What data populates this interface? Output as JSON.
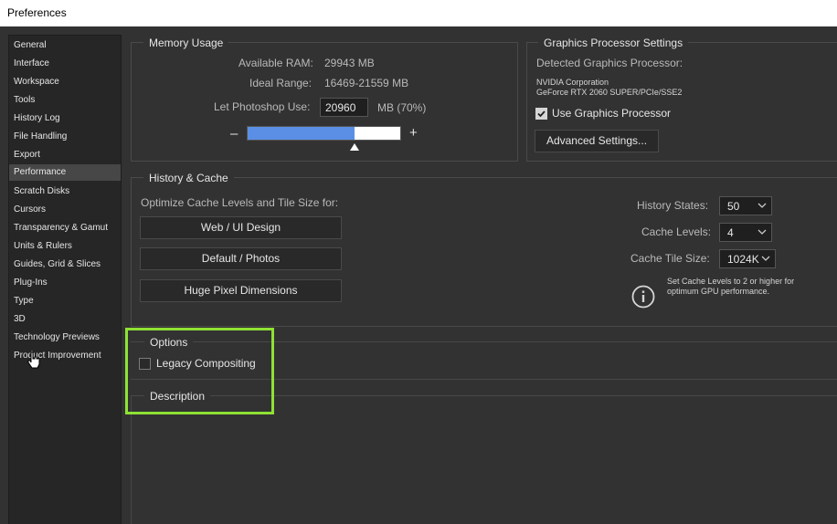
{
  "window": {
    "title": "Preferences"
  },
  "sidebar": {
    "items": [
      {
        "label": "General"
      },
      {
        "label": "Interface"
      },
      {
        "label": "Workspace"
      },
      {
        "label": "Tools"
      },
      {
        "label": "History Log"
      },
      {
        "label": "File Handling"
      },
      {
        "label": "Export"
      },
      {
        "label": "Performance",
        "active": true
      },
      {
        "label": "Scratch Disks"
      },
      {
        "label": "Cursors"
      },
      {
        "label": "Transparency & Gamut"
      },
      {
        "label": "Units & Rulers"
      },
      {
        "label": "Guides, Grid & Slices"
      },
      {
        "label": "Plug-Ins"
      },
      {
        "label": "Type"
      },
      {
        "label": "3D"
      },
      {
        "label": "Technology Previews"
      },
      {
        "label": "Product Improvement"
      }
    ]
  },
  "memory": {
    "title": "Memory Usage",
    "available_label": "Available RAM:",
    "available_value": "29943 MB",
    "ideal_label": "Ideal Range:",
    "ideal_value": "16469-21559 MB",
    "use_label": "Let Photoshop Use:",
    "use_value": "20960",
    "use_unit": "MB (70%)",
    "minus": "–",
    "plus": "+",
    "slider_fraction": 0.7
  },
  "gpu": {
    "title": "Graphics Processor Settings",
    "detected_label": "Detected Graphics Processor:",
    "vendor": "NVIDIA Corporation",
    "model": "GeForce RTX 2060 SUPER/PCIe/SSE2",
    "use_gpu_label": "Use Graphics Processor",
    "use_gpu_checked": true,
    "advanced_button": "Advanced Settings..."
  },
  "history_cache": {
    "title": "History & Cache",
    "optimize_label": "Optimize Cache Levels and Tile Size for:",
    "buttons": [
      "Web / UI Design",
      "Default / Photos",
      "Huge Pixel Dimensions"
    ],
    "history_states_label": "History States:",
    "history_states_value": "50",
    "cache_levels_label": "Cache Levels:",
    "cache_levels_value": "4",
    "tile_size_label": "Cache Tile Size:",
    "tile_size_value": "1024K",
    "info_line1": "Set Cache Levels to 2 or higher for",
    "info_line2": "optimum GPU performance."
  },
  "options": {
    "title": "Options",
    "legacy_label": "Legacy Compositing",
    "legacy_checked": false
  },
  "description": {
    "title": "Description"
  },
  "colors": {
    "accent": "#5b8fe5",
    "highlight": "#8ee234"
  }
}
